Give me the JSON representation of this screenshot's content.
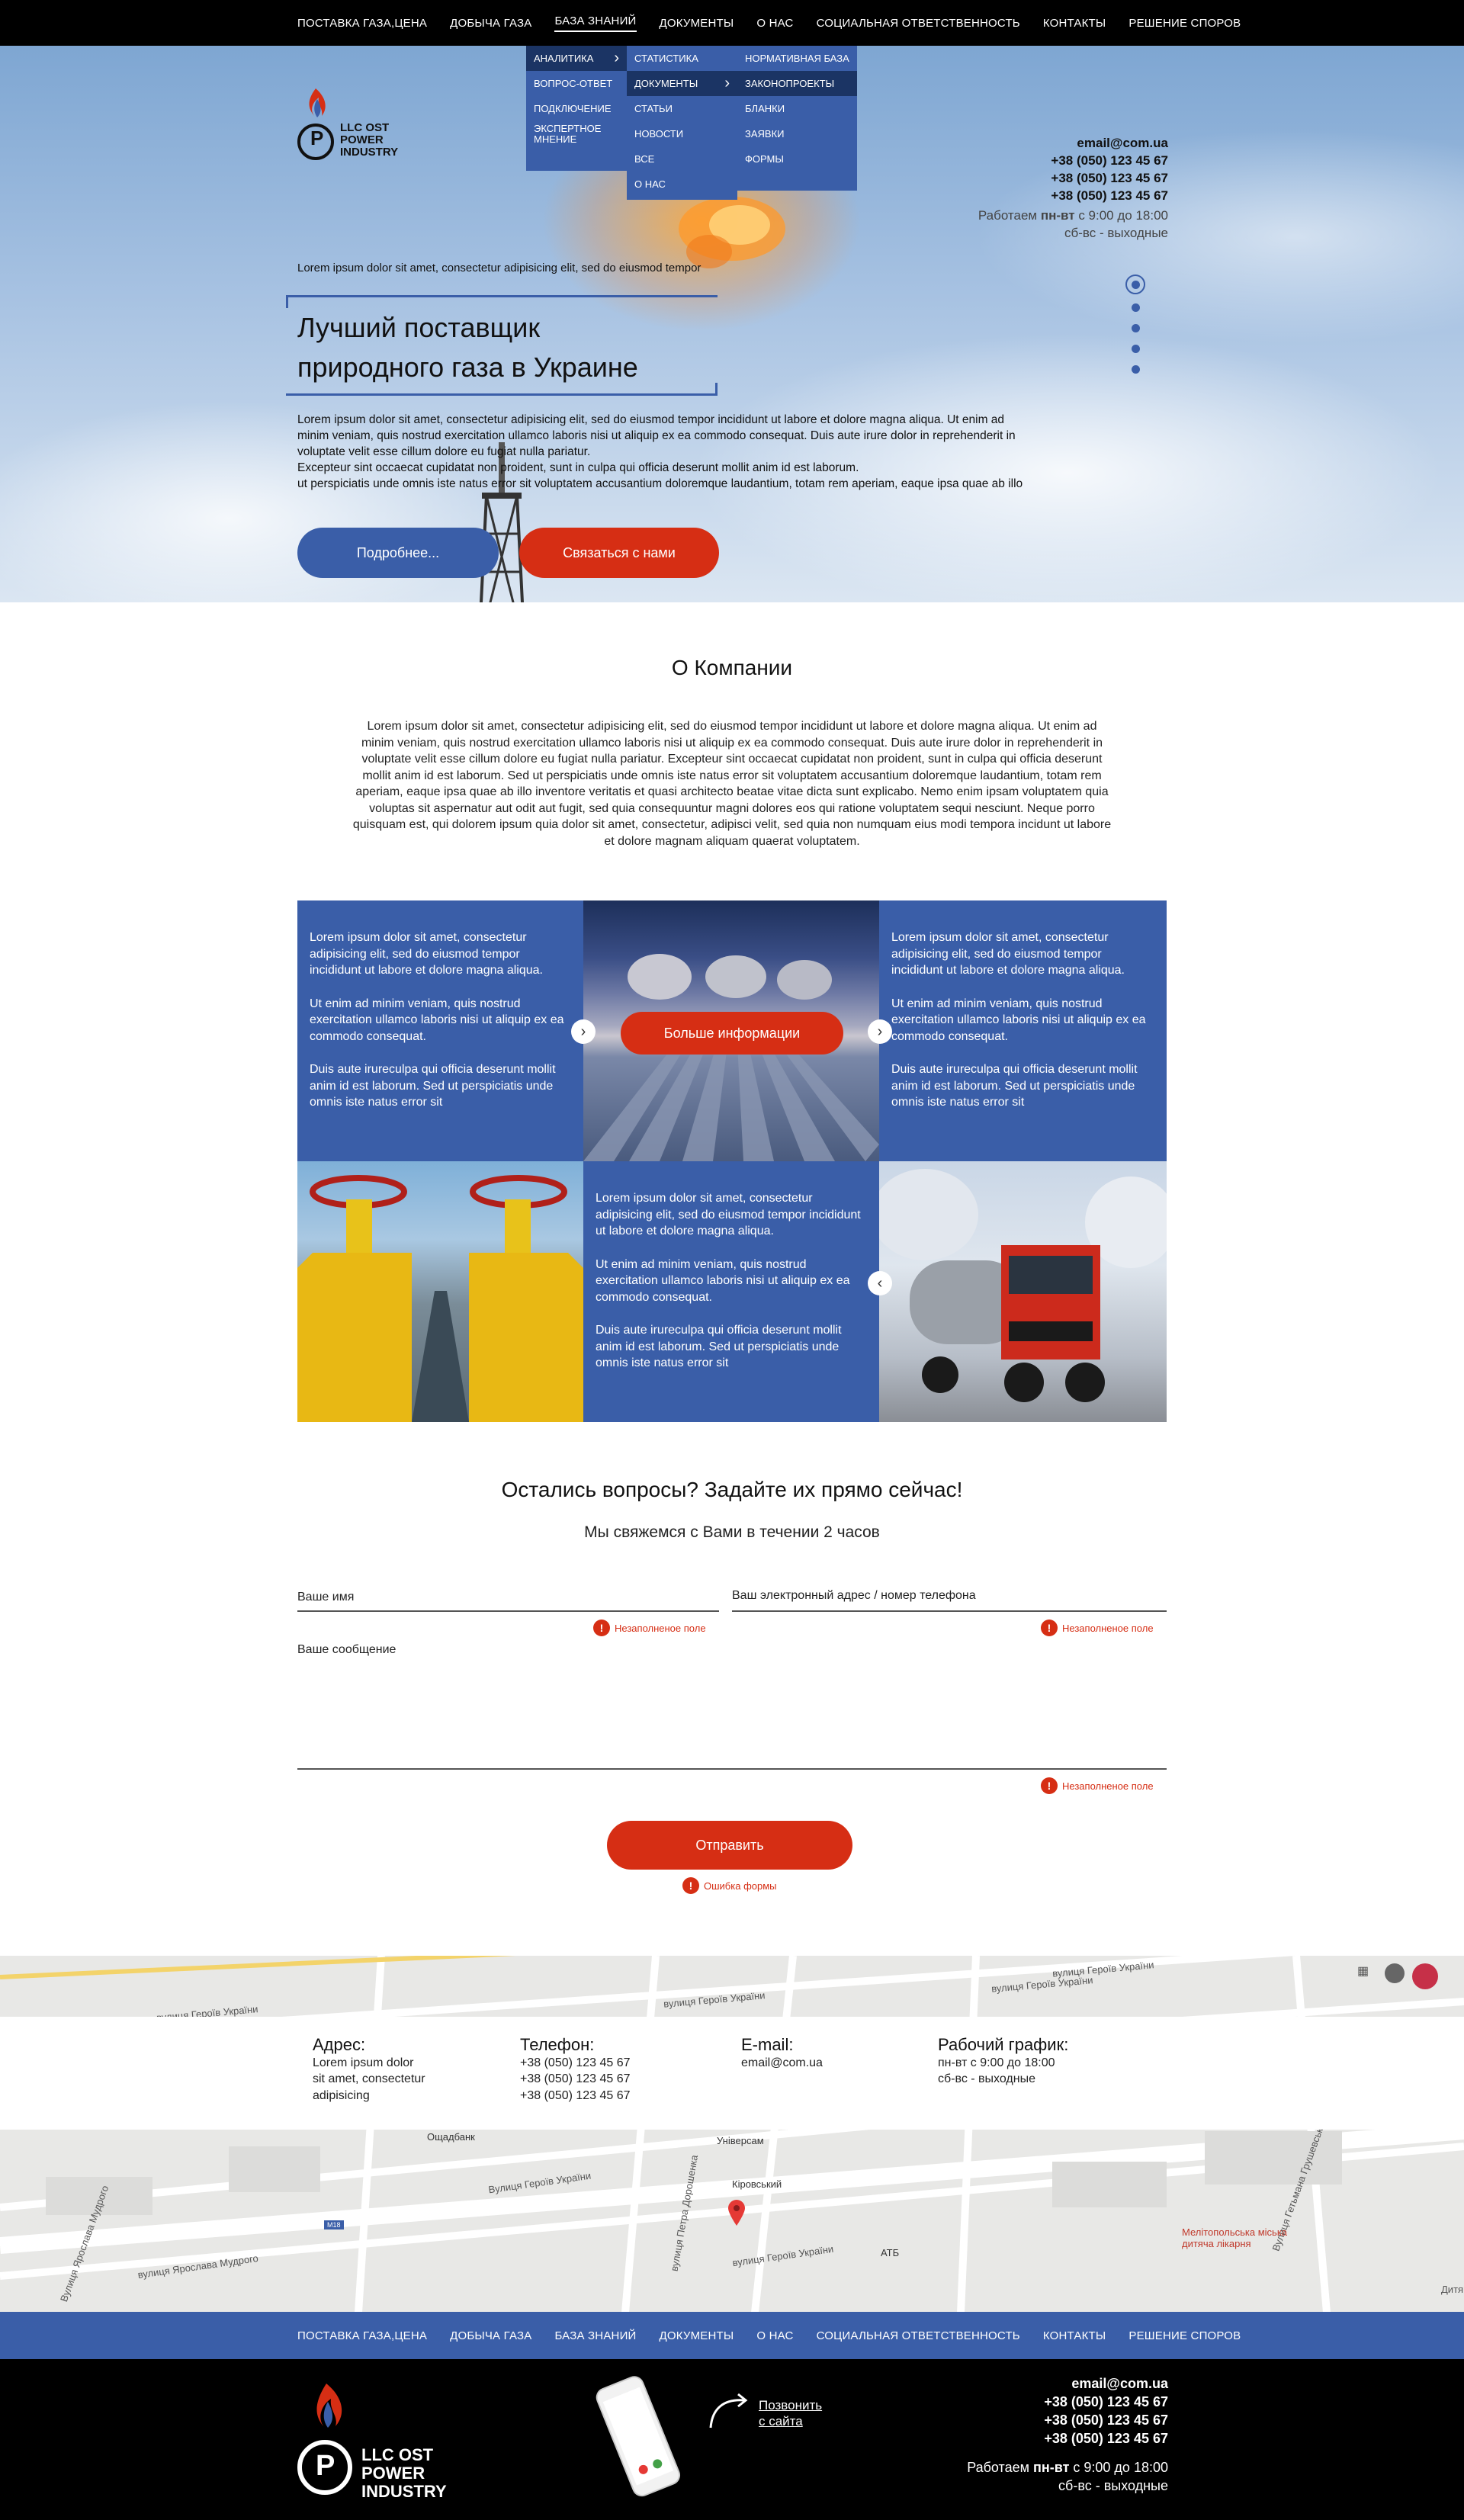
{
  "nav": {
    "items": [
      "ПОСТАВКА ГАЗА,ЦЕНА",
      "ДОБЫЧА ГАЗА",
      "БАЗА ЗНАНИЙ",
      "ДОКУМЕНТЫ",
      "О НАС",
      "СОЦИАЛЬНАЯ ОТВЕТСТВЕННОСТЬ",
      "КОНТАКТЫ",
      "РЕШЕНИЕ СПОРОВ"
    ],
    "active_index": 2
  },
  "dropdown": {
    "col1": [
      "АНАЛИТИКА",
      "ВОПРОС-ОТВЕТ",
      "ПОДКЛЮЧЕНИЕ",
      "ЭКСПЕРТНОЕ МНЕНИЕ"
    ],
    "col2": [
      "СТАТИСТИКА",
      "ДОКУМЕНТЫ",
      "СТАТЬИ",
      "НОВОСТИ",
      "ВСЕ",
      "О НАС"
    ],
    "col3": [
      "НОРМАТИВНАЯ БАЗА",
      "ЗАКОНОПРОЕКТЫ",
      "БЛАНКИ",
      "ЗАЯВКИ",
      "ФОРМЫ"
    ]
  },
  "logo": {
    "line1": "LLC OST",
    "line2": "POWER",
    "line3": "INDUSTRY",
    "letter": "P"
  },
  "contacts": {
    "email": "email@com.ua",
    "phones": [
      "+38 (050) 123 45 67",
      "+38 (050) 123 45 67",
      "+38 (050) 123 45 67"
    ],
    "schedule_prefix": "Работаем ",
    "schedule_days": "пн-вт",
    "schedule_time": " с 9:00 до 18:00",
    "weekend": "сб-вс - выходные"
  },
  "hero": {
    "subtitle": "Lorem ipsum dolor sit amet, consectetur adipisicing elit, sed do eiusmod tempor",
    "title_line1": "Лучший поставщик",
    "title_line2": "природного газа в Украине",
    "text_lines": [
      "Lorem ipsum dolor sit amet, consectetur adipisicing elit, sed do eiusmod tempor incididunt ut labore et dolore magna aliqua. Ut enim ad",
      "minim veniam, quis nostrud exercitation ullamco laboris nisi ut aliquip ex ea commodo consequat. Duis aute irure dolor in reprehenderit in",
      "voluptate velit esse cillum dolore eu fugiat nulla pariatur.",
      "Excepteur sint occaecat cupidatat non proident, sunt in culpa qui officia deserunt mollit anim id est laborum.",
      "ut perspiciatis unde omnis iste natus error sit voluptatem accusantium doloremque laudantium, totam rem aperiam, eaque ipsa quae ab illo"
    ],
    "btn_more": "Подробнее...",
    "btn_contact": "Связаться с нами"
  },
  "about": {
    "title": "О Компании",
    "lines": [
      "Lorem ipsum dolor sit amet, consectetur adipisicing elit, sed do eiusmod tempor incididunt ut labore et dolore magna aliqua. Ut enim ad",
      "minim veniam, quis nostrud exercitation ullamco laboris nisi ut aliquip ex ea commodo consequat. Duis aute irure dolor in reprehenderit in",
      "voluptate velit esse cillum dolore eu fugiat nulla pariatur. Excepteur sint occaecat cupidatat non proident, sunt in culpa qui officia deserunt",
      "mollit anim id est laborum. Sed ut perspiciatis unde omnis iste natus error sit voluptatem accusantium doloremque laudantium, totam rem",
      "aperiam, eaque ipsa quae ab illo inventore veritatis et quasi architecto beatae vitae dicta sunt explicabo. Nemo enim ipsam voluptatem quia",
      "voluptas sit aspernatur aut odit aut fugit, sed quia consequuntur magni dolores eos qui ratione voluptatem sequi nesciunt. Neque porro",
      "quisquam est, qui dolorem ipsum quia dolor sit amet, consectetur, adipisci velit, sed quia non numquam eius modi tempora incidunt ut labore",
      "et dolore magnam aliquam quaerat voluptatem."
    ]
  },
  "tiles": {
    "p1": "Lorem ipsum dolor sit amet, consectetur adipisicing elit, sed do eiusmod tempor incididunt ut labore et dolore magna aliqua.",
    "p2": "Ut enim ad minim veniam, quis nostrud exercitation ullamco laboris nisi ut aliquip ex ea commodo consequat.",
    "p3": "Duis aute irureculpa qui officia deserunt mollit anim id est laborum. Sed ut perspiciatis unde omnis iste natus error sit",
    "more_btn": "Больше информации"
  },
  "form": {
    "title": "Остались вопросы? Задайте их прямо сейчас!",
    "subtitle": "Мы свяжемся с Вами в течении 2 часов",
    "name_placeholder": "Ваше имя",
    "contact_placeholder": "Ваш электронный адрес / номер телефона",
    "message_placeholder": "Ваше сообщение",
    "field_error": "Незаполненое поле",
    "submit": "Отправить",
    "form_error": "Ошибка формы"
  },
  "map": {
    "streets": [
      "вулиця Героїв України",
      "вулиця Героїв України",
      "вулиця Героїв України",
      "Вулиця Героїв України",
      "вулиця Героїв України",
      "вулиця Ярослава Мудрого",
      "Вулиця Ярослава Мудрого",
      "вулиця Петра Дорошенка",
      "Вулиця Гетьмана Грушевського",
      "вулиця Героїв України"
    ],
    "places": [
      "Ощадбанк",
      "Універсам",
      "Кіровський",
      "АТБ",
      "Мелітопольська міська дитяча лікарня",
      "Дитя"
    ],
    "road_badge": "M18"
  },
  "info": {
    "address_label": "Адрес:",
    "address_lines": [
      "Lorem ipsum dolor",
      "sit amet, consectetur",
      "adipisicing"
    ],
    "phone_label": "Телефон:",
    "email_label": "E-mail:",
    "schedule_label": "Рабочий график:",
    "schedule_lines": [
      "пн-вт с 9:00 до 18:00",
      "сб-вс - выходные"
    ]
  },
  "footer": {
    "call_line1": "Позвонить",
    "call_line2": "с сайта"
  },
  "colors": {
    "brand_blue": "#3a5ea8",
    "accent_red": "#d62e14",
    "black": "#000000"
  }
}
